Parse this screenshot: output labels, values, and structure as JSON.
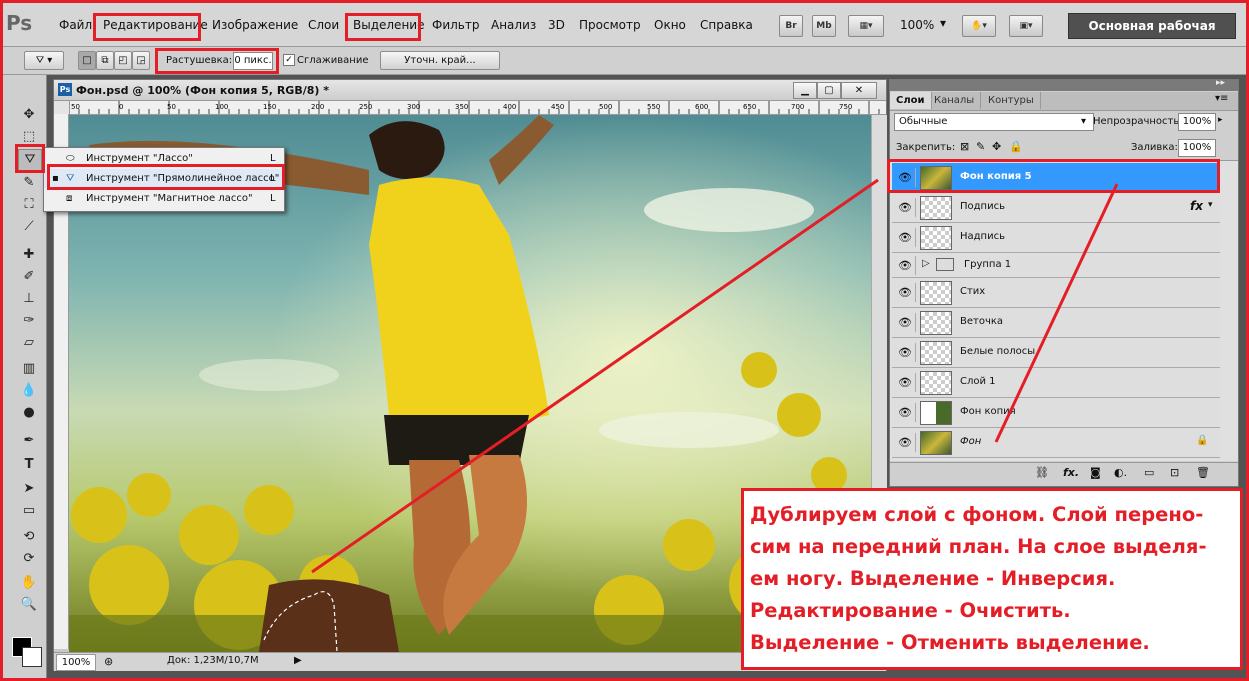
{
  "app": {
    "logo": "Ps",
    "menu": [
      "Файл",
      "Редактирование",
      "Изображение",
      "Слои",
      "Выделение",
      "Фильтр",
      "Анализ",
      "3D",
      "Просмотр",
      "Окно",
      "Справка"
    ],
    "bridge_label": "Br",
    "minibridge_label": "Mb",
    "zoom": "100%",
    "workspace": "Основная рабочая среда"
  },
  "options": {
    "feather_label": "Растушевка:",
    "feather_value": "0 пикс.",
    "antialias_label": "Сглаживание",
    "antialias_checked": true,
    "refine_edge": "Уточн. край..."
  },
  "document": {
    "title": "Фон.psd @ 100% (Фон копия 5, RGB/8) *",
    "zoom": "100%",
    "doc_info": "Док: 1,23M/10,7M",
    "ruler_ticks": [
      "50",
      "0",
      "50",
      "100",
      "150",
      "200",
      "250",
      "300",
      "350",
      "400",
      "450",
      "500",
      "550",
      "600",
      "650",
      "700",
      "750"
    ]
  },
  "flyout": {
    "items": [
      {
        "label": "Инструмент \"Лассо\"",
        "key": "L",
        "icon": "lasso-icon",
        "active": false
      },
      {
        "label": "Инструмент \"Прямолинейное лассо\"",
        "key": "L",
        "icon": "polygonal-lasso-icon",
        "active": true
      },
      {
        "label": "Инструмент \"Магнитное лассо\"",
        "key": "L",
        "icon": "magnetic-lasso-icon",
        "active": false
      }
    ]
  },
  "layers_panel": {
    "tabs": [
      "Слои",
      "Каналы",
      "Контуры"
    ],
    "blend_mode": "Обычные",
    "opacity_label": "Непрозрачность:",
    "opacity_value": "100%",
    "lock_label": "Закрепить:",
    "fill_label": "Заливка:",
    "fill_value": "100%",
    "layers": [
      {
        "name": "Фон копия 5",
        "selected": true
      },
      {
        "name": "Подпись",
        "fx": "fx"
      },
      {
        "name": "Надпись"
      },
      {
        "name": "Группа 1",
        "group": true
      },
      {
        "name": "Стих"
      },
      {
        "name": "Веточка"
      },
      {
        "name": "Белые полосы"
      },
      {
        "name": "Слой 1"
      },
      {
        "name": "Фон копия"
      },
      {
        "name": "Фон",
        "locked": true,
        "italic": true
      }
    ]
  },
  "annotation": {
    "text": "Дублируем слой с фоном. Слой перено-\nсим на передний план. На слое выделя-\nем ногу. Выделение - Инверсия.\nРедактирование - Очистить.\nВыделение - Отменить выделение."
  },
  "colors": {
    "highlight": "#e41e26",
    "selected_layer": "#3399ff"
  }
}
